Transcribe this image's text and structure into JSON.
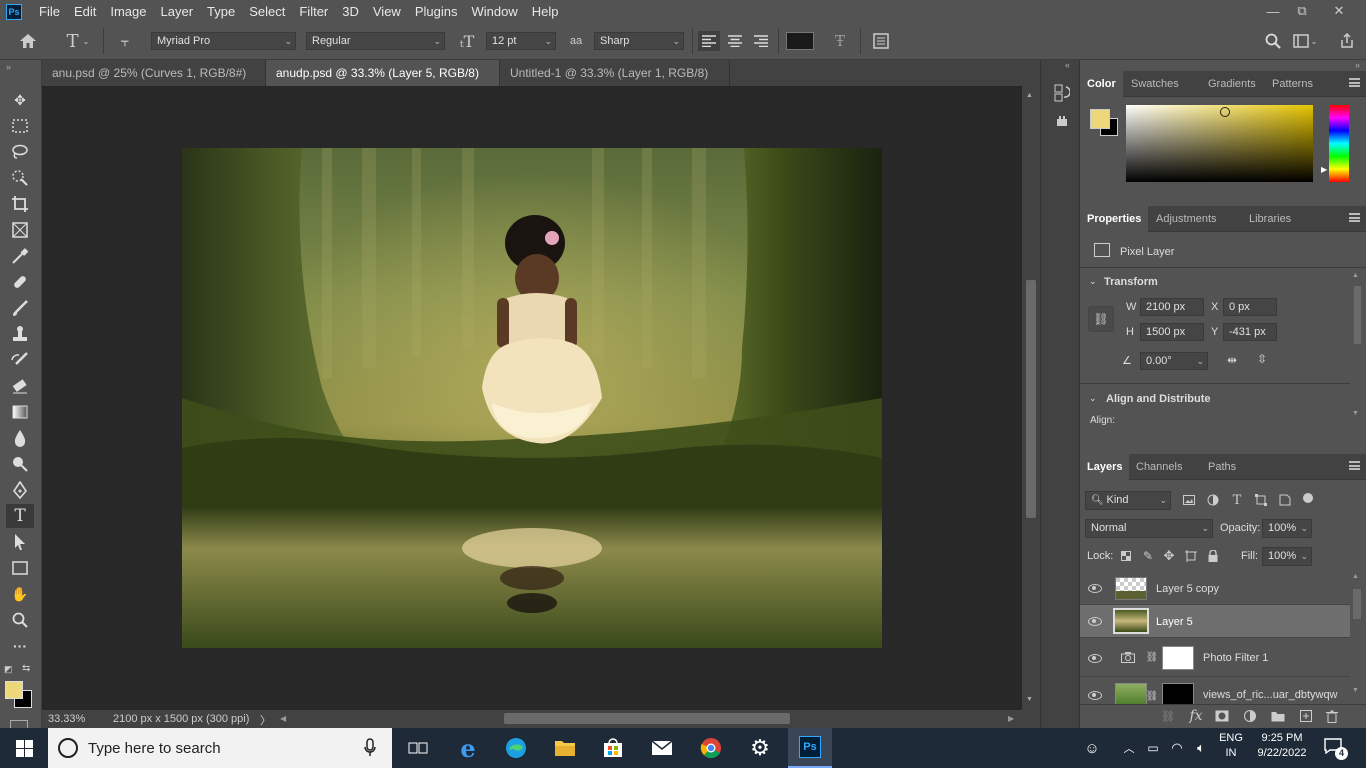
{
  "app": {
    "logo": "Ps"
  },
  "menu": [
    "File",
    "Edit",
    "Image",
    "Layer",
    "Type",
    "Select",
    "Filter",
    "3D",
    "View",
    "Plugins",
    "Window",
    "Help"
  ],
  "window_controls": {
    "minimize": "—",
    "restore": "⧉",
    "close": "✕"
  },
  "options": {
    "font_family": "Myriad Pro",
    "font_style": "Regular",
    "font_size": "12 pt",
    "aa_icon": "aa",
    "antialias": "Sharp",
    "text_color": "#1a1a1a"
  },
  "tabs": [
    {
      "label": "anu.psd @ 25% (Curves 1, RGB/8#) *",
      "active": false
    },
    {
      "label": "anudp.psd @ 33.3% (Layer 5, RGB/8) *",
      "active": true
    },
    {
      "label": "Untitled-1 @ 33.3% (Layer 1, RGB/8) *",
      "active": false
    }
  ],
  "tab_close": "✕",
  "status": {
    "zoom": "33.33%",
    "doc_info": "2100 px x 1500 px (300 ppi)",
    "arrow": "〉"
  },
  "color_panel": {
    "tabs": [
      "Color",
      "Swatches",
      "Gradients",
      "Patterns"
    ],
    "foreground": "#ecd77a",
    "background": "#000000"
  },
  "properties": {
    "tabs": [
      "Properties",
      "Adjustments",
      "Libraries"
    ],
    "kind": "Pixel Layer",
    "transform_title": "Transform",
    "w_label": "W",
    "w": "2100 px",
    "h_label": "H",
    "h": "1500 px",
    "x_label": "X",
    "x": "0 px",
    "y_label": "Y",
    "y": "-431 px",
    "angle": "0.00°",
    "align_title": "Align and Distribute",
    "align_label": "Align:"
  },
  "layers_panel": {
    "tabs": [
      "Layers",
      "Channels",
      "Paths"
    ],
    "filter": "Kind",
    "blend_mode": "Normal",
    "opacity_label": "Opacity:",
    "opacity": "100%",
    "lock_label": "Lock:",
    "fill_label": "Fill:",
    "fill": "100%",
    "layers": [
      {
        "name": "Layer 5 copy",
        "selected": false
      },
      {
        "name": "Layer 5",
        "selected": true
      },
      {
        "name": "Photo Filter 1",
        "selected": false
      },
      {
        "name": "views_of_ric...uar_dbtywqw",
        "selected": false
      }
    ],
    "fx": "fx"
  },
  "taskbar": {
    "search_placeholder": "Type here to search",
    "lang1": "ENG",
    "lang2": "IN",
    "time": "9:25 PM",
    "date": "9/22/2022",
    "notifications": "4"
  }
}
